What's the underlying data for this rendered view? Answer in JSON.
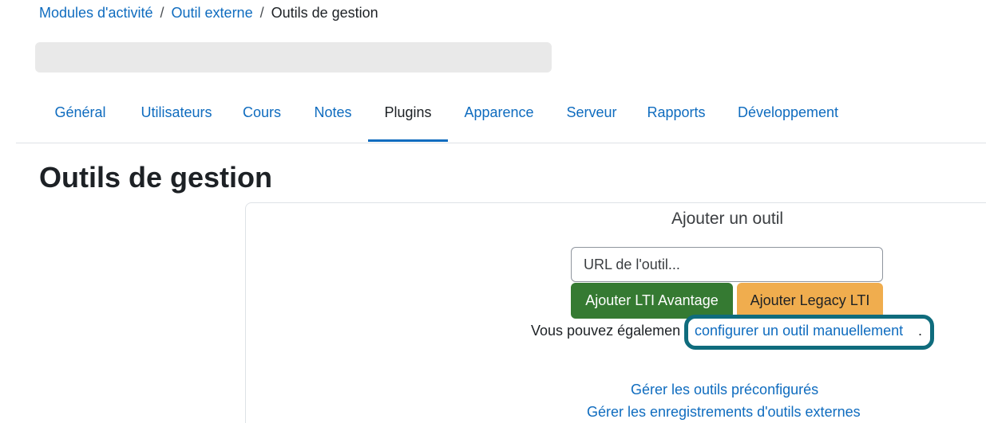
{
  "breadcrumb": {
    "items": [
      "Modules d'activité",
      "Outil externe"
    ],
    "separator": "/",
    "current": "Outils de gestion"
  },
  "tabs": [
    {
      "label": "Général"
    },
    {
      "label": "Utilisateurs"
    },
    {
      "label": "Cours"
    },
    {
      "label": "Notes"
    },
    {
      "label": "Plugins",
      "active": true
    },
    {
      "label": "Apparence"
    },
    {
      "label": "Serveur"
    },
    {
      "label": "Rapports"
    },
    {
      "label": "Développement"
    }
  ],
  "page_title": "Outils de gestion",
  "add_tool": {
    "title": "Ajouter un outil",
    "url_placeholder": "URL de l'outil...",
    "url_value": "",
    "btn_lti_advantage": "Ajouter LTI Avantage",
    "btn_legacy_lti": "Ajouter Legacy LTI",
    "manual_prefix": "Vous pouvez égalemen",
    "manual_link": "configurer un outil manuellement",
    "manual_suffix": "."
  },
  "links": {
    "preconfigured": "Gérer les outils préconfigurés",
    "registrations": "Gérer les enregistrements d'outils externes"
  },
  "colors": {
    "link": "#0f6cbf",
    "primary_green": "#357a32",
    "secondary_orange": "#f0ad4e",
    "highlight_ring": "#0f6c7d"
  }
}
